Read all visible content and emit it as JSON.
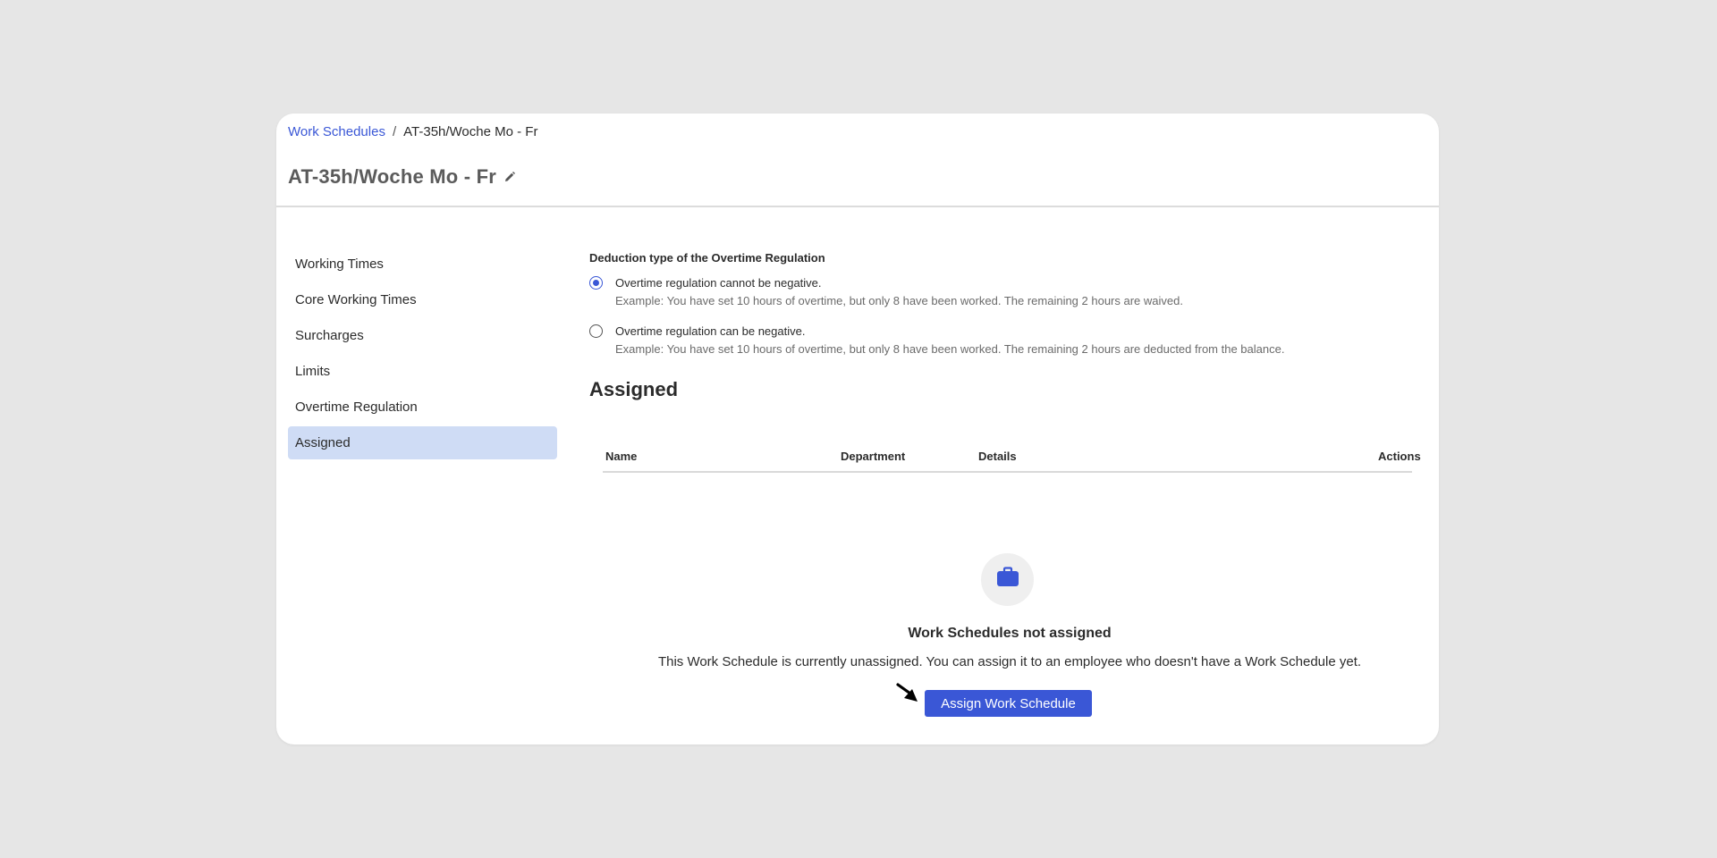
{
  "breadcrumb": {
    "link": "Work Schedules",
    "separator": "/",
    "current": "AT-35h/Woche Mo - Fr"
  },
  "page_title": "AT-35h/Woche Mo - Fr",
  "sidebar": {
    "items": [
      {
        "label": "Working Times"
      },
      {
        "label": "Core Working Times"
      },
      {
        "label": "Surcharges"
      },
      {
        "label": "Limits"
      },
      {
        "label": "Overtime Regulation"
      },
      {
        "label": "Assigned"
      }
    ],
    "active": "Assigned"
  },
  "overtime": {
    "section_label": "Deduction type of the Overtime Regulation",
    "options": [
      {
        "label": "Overtime regulation cannot be negative.",
        "example": "Example: You have set 10 hours of overtime, but only 8 have been worked. The remaining 2 hours are waived.",
        "selected": true
      },
      {
        "label": "Overtime regulation can be negative.",
        "example": "Example: You have set 10 hours of overtime, but only 8 have been worked. The remaining 2 hours are deducted from the balance.",
        "selected": false
      }
    ]
  },
  "assigned": {
    "heading": "Assigned",
    "columns": [
      "Name",
      "Department",
      "Details",
      "Actions"
    ],
    "empty_icon": "briefcase-icon",
    "empty_title": "Work Schedules not assigned",
    "empty_description": "This Work Schedule is currently unassigned. You can assign it to an employee who doesn't have a Work Schedule yet.",
    "assign_button": "Assign Work Schedule"
  },
  "colors": {
    "accent": "#3a57d6",
    "active_sidebar_bg": "#cfdcf5",
    "background": "#e6e6e6"
  }
}
